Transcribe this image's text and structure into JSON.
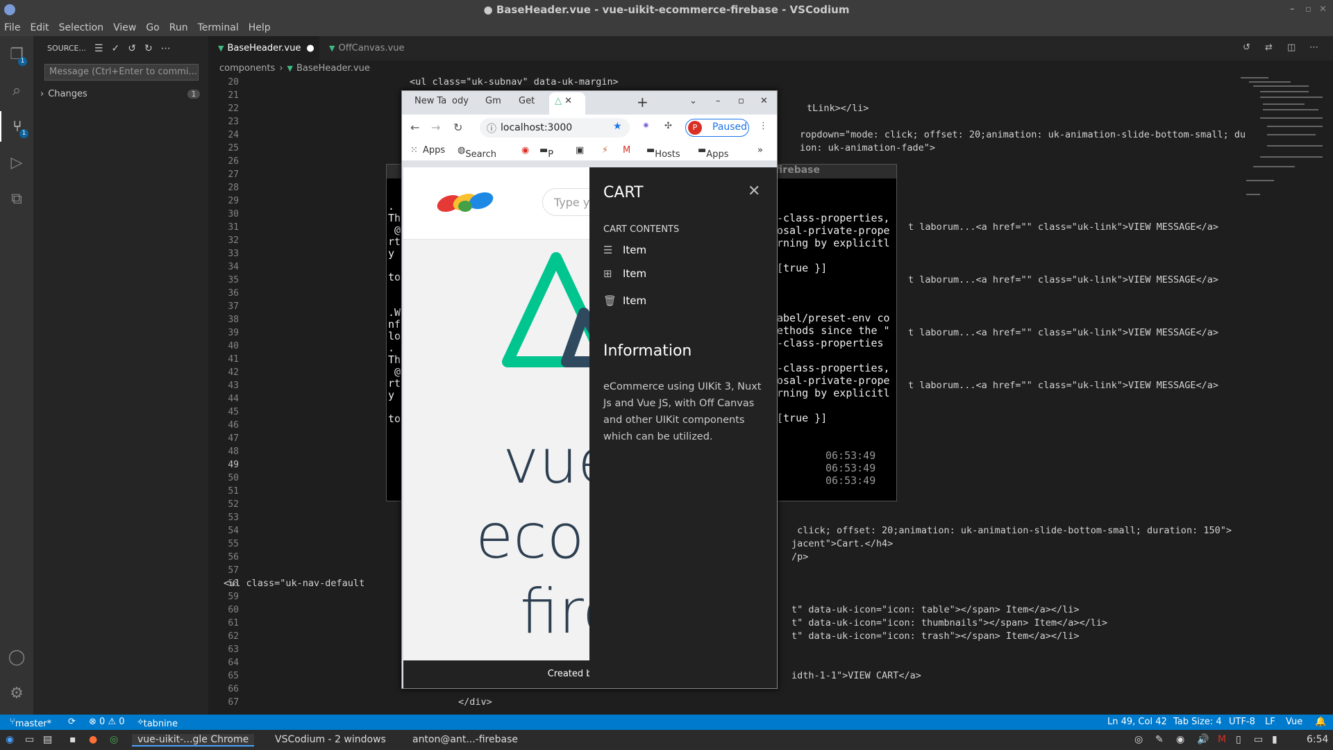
{
  "window": {
    "title": "● BaseHeader.vue - vue-uikit-ecommerce-firebase - VSCodium"
  },
  "menu": [
    "File",
    "Edit",
    "Selection",
    "View",
    "Go",
    "Run",
    "Terminal",
    "Help"
  ],
  "activity_badges": {
    "explorer": "1",
    "scm": "1"
  },
  "sidebar": {
    "title": "SOURCE...",
    "message_placeholder": "Message (Ctrl+Enter to commi...",
    "changes_label": "Changes",
    "changes_count": "1"
  },
  "tabs": [
    {
      "label": "BaseHeader.vue",
      "modified": "●"
    },
    {
      "label": "OffCanvas.vue"
    }
  ],
  "breadcrumb": {
    "folder": "components",
    "file": "BaseHeader.vue"
  },
  "gutter": [
    "20",
    "21",
    "22",
    "23",
    "24",
    "25",
    "26",
    "27",
    "28",
    "29",
    "30",
    "31",
    "32",
    "33",
    "34",
    "35",
    "36",
    "37",
    "38",
    "39",
    "40",
    "41",
    "42",
    "43",
    "44",
    "45",
    "46",
    "47",
    "48",
    "49",
    "50",
    "51",
    "52",
    "53",
    "54",
    "55",
    "56",
    "57",
    "58",
    "59",
    "60",
    "61",
    "62",
    "63",
    "64",
    "65",
    "66",
    "67"
  ],
  "code_lines": [
    {
      "n": 0,
      "text": "<ul class=\"uk-subnav\" data-uk-margin>",
      "indent": 200
    },
    {
      "n": 2,
      "text": "tLink></li>",
      "indent": 772
    },
    {
      "n": 4,
      "text": "ropdown=\"mode: click; offset: 20;animation: uk-animation-slide-bottom-small; du",
      "indent": 762
    },
    {
      "n": 5,
      "text": "ion: uk-animation-fade\">",
      "indent": 762
    },
    {
      "n": 11,
      "text": "t laborum...<a href=\"\" class=\"uk-link\">VIEW MESSAGE</a>",
      "indent": 918
    },
    {
      "n": 15,
      "text": "t laborum...<a href=\"\" class=\"uk-link\">VIEW MESSAGE</a>",
      "indent": 918
    },
    {
      "n": 19,
      "text": "t laborum...<a href=\"\" class=\"uk-link\">VIEW MESSAGE</a>",
      "indent": 918
    },
    {
      "n": 23,
      "text": "t laborum...<a href=\"\" class=\"uk-link\">VIEW MESSAGE</a>",
      "indent": 918
    },
    {
      "n": 34,
      "text": " click; offset: 20;animation: uk-animation-slide-bottom-small; duration: 150\">",
      "indent": 750
    },
    {
      "n": 35,
      "text": "jacent\">Cart.</h4>",
      "indent": 750
    },
    {
      "n": 36,
      "text": "/p>",
      "indent": 750
    },
    {
      "n": 38,
      "text": "<ul class=\"uk-nav-default",
      "indent": -68
    },
    {
      "n": 40,
      "text": "t\" data-uk-icon=\"icon: table\"></span> Item</a></li>",
      "indent": 750
    },
    {
      "n": 41,
      "text": "t\" data-uk-icon=\"icon: thumbnails\"></span> Item</a></li>",
      "indent": 750
    },
    {
      "n": 42,
      "text": "t\" data-uk-icon=\"icon: trash\"></span> Item</a></li>",
      "indent": 750
    },
    {
      "n": 45,
      "text": "idth-1-1\">VIEW CART</a>",
      "indent": 750
    },
    {
      "n": 47,
      "text": "</div>",
      "indent": 270
    }
  ],
  "terminal": {
    "title": "firebase",
    "lines_right": [
      "-class-properties,",
      "osal-private-prope",
      "rning by explicitl",
      "",
      "[true }]",
      "",
      "",
      "",
      "abel/preset-env co",
      "ethods since the \"",
      "-class-properties",
      "",
      "-class-properties,",
      "osal-private-prope",
      "rning by explicitl",
      "",
      "[true }]"
    ],
    "times": [
      "06:53:49",
      "06:53:49",
      "06:53:49"
    ],
    "left_chars": [
      ".",
      "Th",
      " @",
      "rt",
      "y",
      "",
      "to",
      "",
      "",
      ".W",
      "nf",
      "lo",
      ".",
      "Th",
      " @",
      "rt",
      "y",
      "",
      "to"
    ]
  },
  "chrome": {
    "tabs": [
      "New Ta",
      "ody",
      "Gm",
      "Get"
    ],
    "url": "localhost:3000",
    "paused": "Paused",
    "avatar": "P",
    "bookmarks": [
      "Apps",
      "Search",
      "P",
      "Hosts",
      "Apps"
    ],
    "search_placeholder": "Type yo",
    "hero": [
      "vue-u",
      "ecomm",
      "fireb"
    ],
    "footer": "Created by Xhosto"
  },
  "cart": {
    "title": "CART",
    "contents_label": "CART CONTENTS",
    "items": [
      "Item",
      "Item",
      "Item"
    ],
    "info_title": "Information",
    "info_text": "eCommerce using UIKit 3, Nuxt Js and Vue JS, with Off Canvas and other UIKit components which can be utilized."
  },
  "status": {
    "branch": "master*",
    "problems": "⊗ 0 ⚠ 0",
    "tabnine": "tabnine",
    "position": "Ln 49, Col 42",
    "tabsize": "Tab Size: 4",
    "encoding": "UTF-8",
    "eol": "LF",
    "lang": "Vue"
  },
  "taskbar": {
    "items": [
      "vue-uikit-...gle Chrome",
      "VSCodium - 2 windows",
      "anton@ant...-firebase"
    ],
    "clock": "6:54"
  }
}
